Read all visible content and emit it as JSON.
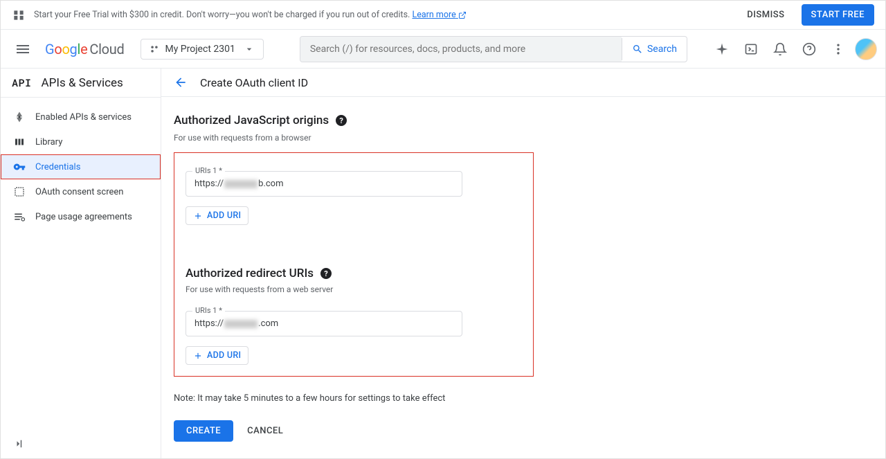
{
  "banner": {
    "text_prefix": "Start your Free Trial with $300 in credit. Don't worry—you won't be charged if you run out of credits. ",
    "learn_more": "Learn more",
    "dismiss": "DISMISS",
    "start_free": "START FREE"
  },
  "topbar": {
    "logo_cloud": "Cloud",
    "project": "My Project 2301",
    "search_placeholder": "Search (/) for resources, docs, products, and more",
    "search_button": "Search"
  },
  "sidebar": {
    "badge": "API",
    "title": "APIs & Services",
    "items": [
      {
        "label": "Enabled APIs & services",
        "active": false
      },
      {
        "label": "Library",
        "active": false
      },
      {
        "label": "Credentials",
        "active": true
      },
      {
        "label": "OAuth consent screen",
        "active": false
      },
      {
        "label": "Page usage agreements",
        "active": false
      }
    ]
  },
  "page": {
    "title": "Create OAuth client ID",
    "js_origins": {
      "title": "Authorized JavaScript origins",
      "subtitle": "For use with requests from a browser",
      "field_label": "URIs 1 *",
      "prefix": "https://",
      "suffix": "b.com",
      "add_button": "ADD URI"
    },
    "redirect_uris": {
      "title": "Authorized redirect URIs",
      "subtitle": "For use with requests from a web server",
      "field_label": "URIs 1 *",
      "prefix": "https://",
      "suffix": ".com",
      "add_button": "ADD URI"
    },
    "note": "Note: It may take 5 minutes to a few hours for settings to take effect",
    "create": "CREATE",
    "cancel": "CANCEL"
  }
}
